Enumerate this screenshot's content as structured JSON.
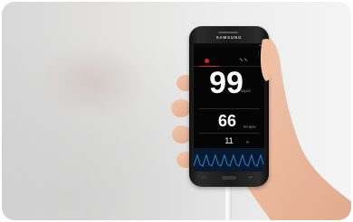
{
  "device": {
    "brand": "SAMSUNG"
  },
  "screen": {
    "spo2_value": "99",
    "spo2_unit": "%SpO2",
    "pr_value": "66",
    "pr_unit": "PR BPM",
    "pi_value": "11",
    "pi_unit": "PI"
  },
  "icons": {
    "heart": "heart-icon",
    "waveform": "waveform-icon",
    "menu": "menu-icon"
  },
  "colors": {
    "accent": "#d4242c",
    "pleth_wave": "#2f7fd6",
    "screen_bg": "#050505"
  }
}
